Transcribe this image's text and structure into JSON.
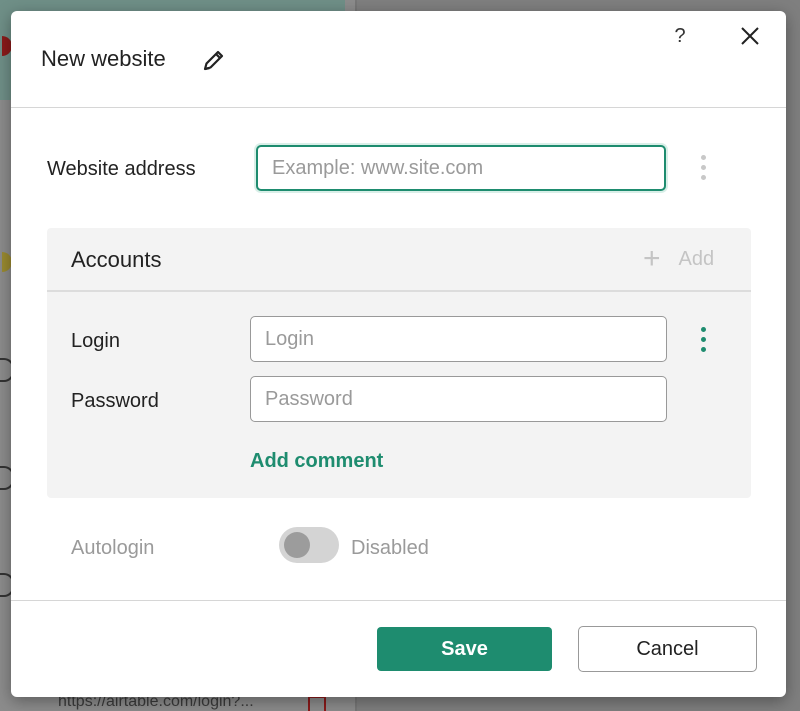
{
  "background": {
    "url_snippet": "https://airtable.com/login?..."
  },
  "dialog": {
    "title": "New website",
    "edit_icon": "pencil-icon",
    "help_label": "?",
    "close_icon": "close-icon"
  },
  "website": {
    "label": "Website address",
    "value": "",
    "placeholder": "Example: www.site.com"
  },
  "accounts": {
    "title": "Accounts",
    "add_label": "Add",
    "login_label": "Login",
    "login_placeholder": "Login",
    "password_label": "Password",
    "password_placeholder": "Password",
    "add_comment": "Add comment"
  },
  "autologin": {
    "label": "Autologin",
    "state": "Disabled",
    "enabled": false
  },
  "footer": {
    "save_label": "Save",
    "cancel_label": "Cancel"
  },
  "colors": {
    "accent": "#1e8c6f",
    "disabled_text": "#9a9a9a"
  }
}
